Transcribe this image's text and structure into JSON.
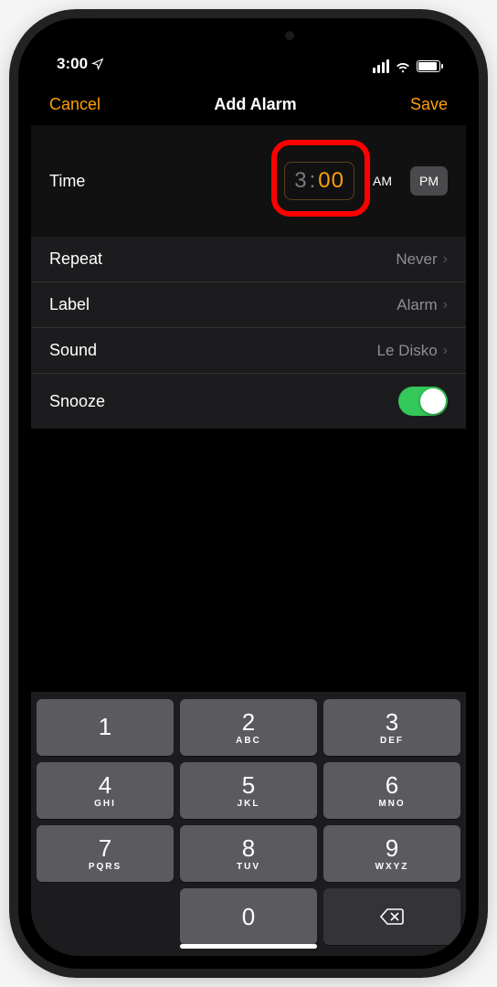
{
  "status": {
    "time": "3:00"
  },
  "nav": {
    "cancel": "Cancel",
    "title": "Add Alarm",
    "save": "Save"
  },
  "time": {
    "label": "Time",
    "hour": "3",
    "minute": "00",
    "am": "AM",
    "pm": "PM"
  },
  "rows": {
    "repeat": {
      "label": "Repeat",
      "value": "Never"
    },
    "labelRow": {
      "label": "Label",
      "value": "Alarm"
    },
    "sound": {
      "label": "Sound",
      "value": "Le Disko"
    },
    "snooze": {
      "label": "Snooze"
    }
  },
  "keypad": {
    "k1": {
      "d": "1",
      "l": ""
    },
    "k2": {
      "d": "2",
      "l": "ABC"
    },
    "k3": {
      "d": "3",
      "l": "DEF"
    },
    "k4": {
      "d": "4",
      "l": "GHI"
    },
    "k5": {
      "d": "5",
      "l": "JKL"
    },
    "k6": {
      "d": "6",
      "l": "MNO"
    },
    "k7": {
      "d": "7",
      "l": "PQRS"
    },
    "k8": {
      "d": "8",
      "l": "TUV"
    },
    "k9": {
      "d": "9",
      "l": "WXYZ"
    },
    "k0": {
      "d": "0",
      "l": ""
    }
  }
}
